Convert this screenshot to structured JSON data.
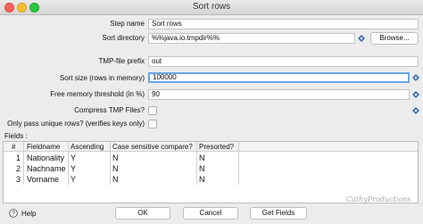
{
  "window": {
    "title": "Sort rows"
  },
  "form": {
    "step_name": {
      "label": "Step name",
      "value": "Sort rows"
    },
    "sort_directory": {
      "label": "Sort directory",
      "value": "%%java.io.tmpdir%%",
      "browse_label": "Browse..."
    },
    "tmp_prefix": {
      "label": "TMP-file prefix",
      "value": "out"
    },
    "sort_size": {
      "label": "Sort size (rows in memory)",
      "value": "100000"
    },
    "free_memory": {
      "label": "Free memory threshold (in %)",
      "value": "90"
    },
    "compress": {
      "label": "Compress TMP Files?"
    },
    "unique_rows": {
      "label": "Only pass unique rows? (verifies keys only)"
    }
  },
  "fields": {
    "label": "Fields :",
    "columns": [
      "#",
      "Fieldname",
      "Ascending",
      "Case sensitive compare?",
      "Presorted?"
    ],
    "rows": [
      {
        "num": "1",
        "fieldname": "Nationality",
        "ascending": "Y",
        "case_sensitive": "N",
        "presorted": "N"
      },
      {
        "num": "2",
        "fieldname": "Nachname",
        "ascending": "Y",
        "case_sensitive": "N",
        "presorted": "N"
      },
      {
        "num": "3",
        "fieldname": "Vorname",
        "ascending": "Y",
        "case_sensitive": "N",
        "presorted": "N"
      }
    ]
  },
  "buttons": {
    "help": "Help",
    "ok": "OK",
    "cancel": "Cancel",
    "get_fields": "Get Fields"
  },
  "watermark": "CathyProductions",
  "colors": {
    "focus_border": "#6aa6e8",
    "variable_icon": "#3d6fb0"
  }
}
